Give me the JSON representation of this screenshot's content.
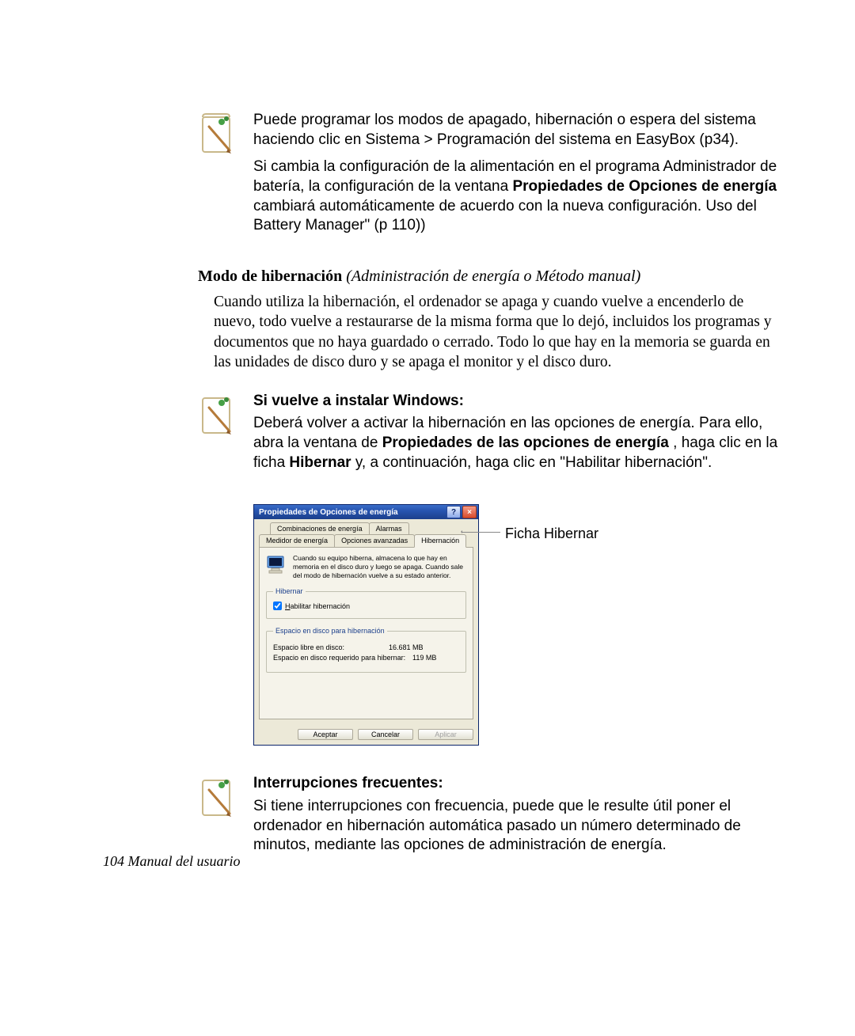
{
  "note1": {
    "para1": "Puede programar los modos de apagado, hibernación o espera del sistema haciendo clic en Sistema > Programación del sistema en EasyBox (p34).",
    "para2_pre": "Si cambia la configuración de la alimentación en el programa Administrador de batería, la configuración de la ventana ",
    "para2_bold": "Propiedades de Opciones de energía",
    "para2_post": " cambiará automáticamente de acuerdo con la nueva configuración. Uso del Battery Manager\" (p 110))"
  },
  "section": {
    "title_bold": "Modo de hibernación",
    "title_italic": " (Administración de energía o Método manual)",
    "body": "Cuando utiliza la hibernación, el ordenador se apaga y cuando vuelve a encenderlo de nuevo, todo vuelve a restaurarse de la misma forma que lo dejó, incluidos los programas y documentos que no haya guardado o cerrado. Todo lo que hay en la memoria se guarda en las unidades de disco duro y se apaga el monitor y el disco duro."
  },
  "note2": {
    "head": "Si vuelve a instalar Windows:",
    "body_pre": "Deberá volver a activar la hibernación en las opciones de energía. Para ello, abra la ventana de ",
    "body_bold1": "Propiedades de las opciones de energía",
    "body_mid": " , haga clic en la ficha ",
    "body_bold2": "Hibernar",
    "body_post": " y, a continuación, haga clic en \"Habilitar hibernación\"."
  },
  "dialog": {
    "title": "Propiedades de Opciones de energía",
    "help_glyph": "?",
    "close_glyph": "×",
    "tabs_row1": [
      "Combinaciones de energía",
      "Alarmas"
    ],
    "tabs_row2": [
      "Medidor de energía",
      "Opciones avanzadas",
      "Hibernación"
    ],
    "info_text": "Cuando su equipo hiberna, almacena lo que hay en memoria en el disco duro y luego se apaga. Cuando sale del modo de hibernación vuelve a su estado anterior.",
    "group1_legend": "Hibernar",
    "checkbox_label": "Habilitar hibernación",
    "group2_legend": "Espacio en disco para hibernación",
    "kv1_k": "Espacio libre en disco:",
    "kv1_v": "16.681 MB",
    "kv2_k": "Espacio en disco requerido para hibernar:",
    "kv2_v": "119 MB",
    "btn_ok": "Aceptar",
    "btn_cancel": "Cancelar",
    "btn_apply": "Aplicar",
    "callout": "Ficha Hibernar"
  },
  "note3": {
    "head": "Interrupciones frecuentes:",
    "body": "Si tiene interrupciones con frecuencia, puede que le resulte útil poner el ordenador en hibernación automática pasado un número determinado de minutos, mediante las opciones de administración de energía."
  },
  "footer": "104  Manual del usuario"
}
